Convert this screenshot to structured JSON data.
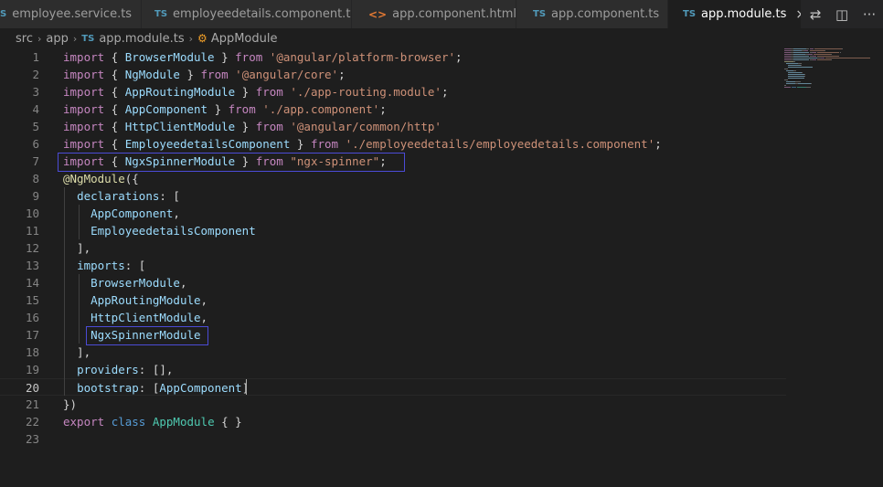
{
  "tabs": [
    {
      "icon": "S",
      "icon_type": "ts",
      "label": "employee.service.ts",
      "active": false
    },
    {
      "icon": "TS",
      "icon_type": "ts",
      "label": "employeedetails.component.ts",
      "active": false
    },
    {
      "icon": "<>",
      "icon_type": "html",
      "label": "app.component.html",
      "active": false
    },
    {
      "icon": "TS",
      "icon_type": "ts",
      "label": "app.component.ts",
      "active": false
    },
    {
      "icon": "TS",
      "icon_type": "ts",
      "label": "app.module.ts",
      "active": true
    }
  ],
  "tab_actions": {
    "close": "×",
    "compare": "⇄",
    "split": "◫",
    "more": "···"
  },
  "breadcrumb": {
    "parts": [
      "src",
      "app"
    ],
    "file_icon": "TS",
    "file": "app.module.ts",
    "symbol": "AppModule",
    "separator": "›"
  },
  "editor": {
    "current_line": 20,
    "lines": [
      {
        "n": "1",
        "tokens": [
          [
            "kw",
            "import"
          ],
          [
            "br",
            " { "
          ],
          [
            "id",
            "BrowserModule"
          ],
          [
            "br",
            " } "
          ],
          [
            "kw",
            "from"
          ],
          [
            "br",
            " "
          ],
          [
            "str",
            "'@angular/platform-browser'"
          ],
          [
            "br",
            ";"
          ]
        ]
      },
      {
        "n": "2",
        "tokens": [
          [
            "kw",
            "import"
          ],
          [
            "br",
            " { "
          ],
          [
            "id",
            "NgModule"
          ],
          [
            "br",
            " } "
          ],
          [
            "kw",
            "from"
          ],
          [
            "br",
            " "
          ],
          [
            "str",
            "'@angular/core'"
          ],
          [
            "br",
            ";"
          ]
        ]
      },
      {
        "n": "3",
        "tokens": [
          [
            "kw",
            "import"
          ],
          [
            "br",
            " { "
          ],
          [
            "id",
            "AppRoutingModule"
          ],
          [
            "br",
            " } "
          ],
          [
            "kw",
            "from"
          ],
          [
            "br",
            " "
          ],
          [
            "str",
            "'./app-routing.module'"
          ],
          [
            "br",
            ";"
          ]
        ]
      },
      {
        "n": "4",
        "tokens": [
          [
            "kw",
            "import"
          ],
          [
            "br",
            " { "
          ],
          [
            "id",
            "AppComponent"
          ],
          [
            "br",
            " } "
          ],
          [
            "kw",
            "from"
          ],
          [
            "br",
            " "
          ],
          [
            "str",
            "'./app.component'"
          ],
          [
            "br",
            ";"
          ]
        ]
      },
      {
        "n": "5",
        "tokens": [
          [
            "kw",
            "import"
          ],
          [
            "br",
            " { "
          ],
          [
            "id",
            "HttpClientModule"
          ],
          [
            "br",
            " } "
          ],
          [
            "kw",
            "from"
          ],
          [
            "br",
            " "
          ],
          [
            "str",
            "'@angular/common/http'"
          ]
        ]
      },
      {
        "n": "6",
        "tokens": [
          [
            "kw",
            "import"
          ],
          [
            "br",
            " { "
          ],
          [
            "id",
            "EmployeedetailsComponent"
          ],
          [
            "br",
            " } "
          ],
          [
            "kw",
            "from"
          ],
          [
            "br",
            " "
          ],
          [
            "str",
            "'./employeedetails/employeedetails.component'"
          ],
          [
            "br",
            ";"
          ]
        ]
      },
      {
        "n": "7",
        "tokens": [
          [
            "kw",
            "import"
          ],
          [
            "br",
            " { "
          ],
          [
            "id",
            "NgxSpinnerModule"
          ],
          [
            "br",
            " } "
          ],
          [
            "kw",
            "from"
          ],
          [
            "br",
            " "
          ],
          [
            "str",
            "\"ngx-spinner\""
          ],
          [
            "br",
            ";"
          ]
        ]
      },
      {
        "n": "8",
        "tokens": [
          [
            "dec",
            "@NgModule"
          ],
          [
            "br",
            "({"
          ]
        ]
      },
      {
        "n": "9",
        "tokens": [
          [
            "br",
            "  "
          ],
          [
            "id",
            "declarations"
          ],
          [
            "br",
            ": ["
          ]
        ]
      },
      {
        "n": "10",
        "tokens": [
          [
            "br",
            "    "
          ],
          [
            "id",
            "AppComponent"
          ],
          [
            "br",
            ","
          ]
        ]
      },
      {
        "n": "11",
        "tokens": [
          [
            "br",
            "    "
          ],
          [
            "id",
            "EmployeedetailsComponent"
          ]
        ]
      },
      {
        "n": "12",
        "tokens": [
          [
            "br",
            "  ],"
          ]
        ]
      },
      {
        "n": "13",
        "tokens": [
          [
            "br",
            "  "
          ],
          [
            "id",
            "imports"
          ],
          [
            "br",
            ": ["
          ]
        ]
      },
      {
        "n": "14",
        "tokens": [
          [
            "br",
            "    "
          ],
          [
            "id",
            "BrowserModule"
          ],
          [
            "br",
            ","
          ]
        ]
      },
      {
        "n": "15",
        "tokens": [
          [
            "br",
            "    "
          ],
          [
            "id",
            "AppRoutingModule"
          ],
          [
            "br",
            ","
          ]
        ]
      },
      {
        "n": "16",
        "tokens": [
          [
            "br",
            "    "
          ],
          [
            "id",
            "HttpClientModule"
          ],
          [
            "br",
            ","
          ]
        ]
      },
      {
        "n": "17",
        "tokens": [
          [
            "br",
            "    "
          ],
          [
            "id",
            "NgxSpinnerModule"
          ]
        ]
      },
      {
        "n": "18",
        "tokens": [
          [
            "br",
            "  ],"
          ]
        ]
      },
      {
        "n": "19",
        "tokens": [
          [
            "br",
            "  "
          ],
          [
            "id",
            "providers"
          ],
          [
            "br",
            ": [],"
          ]
        ]
      },
      {
        "n": "20",
        "tokens": [
          [
            "br",
            "  "
          ],
          [
            "id",
            "bootstrap"
          ],
          [
            "br",
            ": ["
          ],
          [
            "id",
            "AppComponent"
          ],
          [
            "br",
            "]"
          ]
        ]
      },
      {
        "n": "21",
        "tokens": [
          [
            "br",
            "})"
          ]
        ]
      },
      {
        "n": "22",
        "tokens": [
          [
            "kw",
            "export"
          ],
          [
            "br",
            " "
          ],
          [
            "kb",
            "class"
          ],
          [
            "br",
            " "
          ],
          [
            "cls",
            "AppModule"
          ],
          [
            "br",
            " { }"
          ]
        ]
      },
      {
        "n": "23",
        "tokens": []
      }
    ]
  },
  "colors": {
    "background": "#1e1e1e",
    "keyword": "#c586c0",
    "string": "#ce9178",
    "identifier": "#9cdcfe",
    "class_name": "#4ec9b0",
    "highlight_border": "#4b4bd6"
  }
}
